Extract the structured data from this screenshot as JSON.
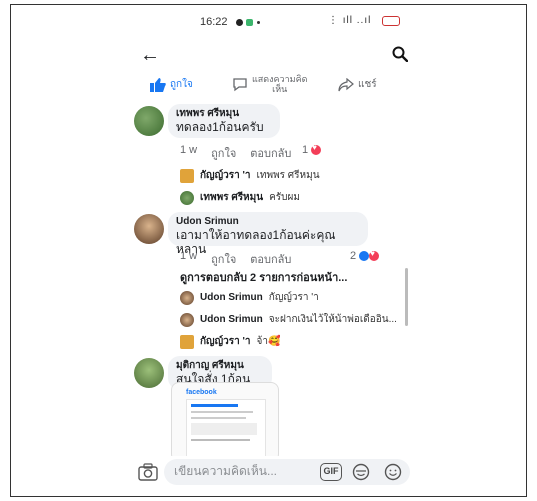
{
  "status": {
    "time": "16:22",
    "signal": "⋮ ıll ..ıl"
  },
  "actions": {
    "like": "ถูกใจ",
    "comment_line1": "แสดงความคิด",
    "comment_line2": "เห็น",
    "share": "แชร์"
  },
  "comments": [
    {
      "name": "เทพพร ศรีหมุน",
      "text": "ทดลอง1ก้อนครับ",
      "time": "1 w",
      "like": "ถูกใจ",
      "reply": "ตอบกลับ",
      "reactions": "1",
      "replies": [
        {
          "name": "กัญญ์วรา 'า",
          "text": "เทพพร ศรีหมุน"
        },
        {
          "name": "เทพพร ศรีหมุน",
          "text": "ครับผม"
        }
      ]
    },
    {
      "name": "Udon Srimun",
      "text": "เอามาให้อาทดลอง1ก้อนค่ะคุณหลาน",
      "time": "1 w",
      "like": "ถูกใจ",
      "reply": "ตอบกลับ",
      "reactions": "2",
      "view_more": "ดูการตอบกลับ 2 รายการก่อนหน้า...",
      "replies": [
        {
          "name": "Udon Srimun",
          "text": "กัญญ์วรา 'า"
        },
        {
          "name": "Udon Srimun",
          "text": "จะฝากเงินไว้ให้น้าพ่อเดืออิน..."
        },
        {
          "name": "กัญญ์วรา 'า",
          "text": "จ้า🥰"
        }
      ]
    },
    {
      "name": "มุติกาญ ศรีหมุน",
      "text": "สนใจสั่ง 1ก้อนจ้า",
      "attachment_brand": "facebook"
    }
  ],
  "composer": {
    "placeholder": "เขียนความคิดเห็น...",
    "gif": "GIF"
  },
  "colors": {
    "brand": "#1877f2",
    "heart": "#f33e58",
    "bubble": "#f0f2f5"
  }
}
